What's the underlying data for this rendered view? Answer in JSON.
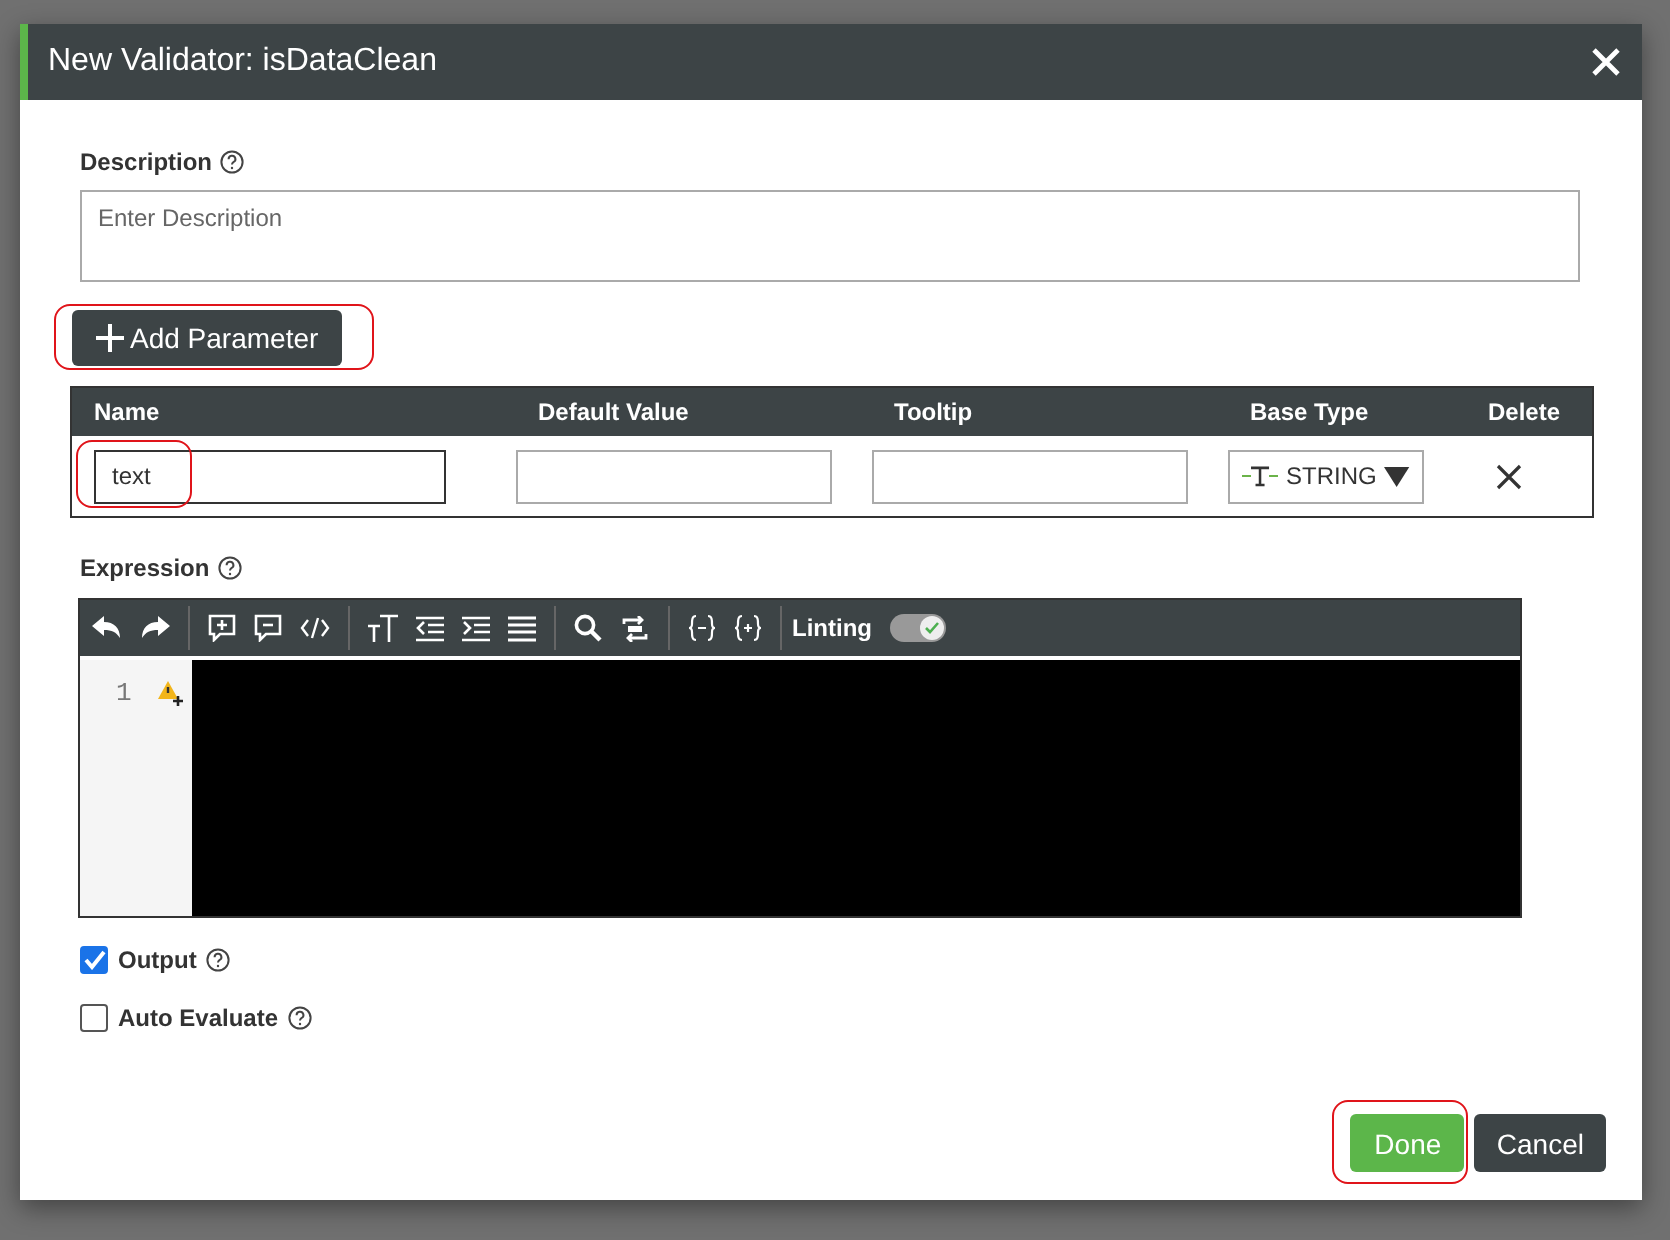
{
  "dialog": {
    "title": "New Validator: isDataClean"
  },
  "description": {
    "label": "Description",
    "placeholder": "Enter Description"
  },
  "add_parameter": {
    "label": "Add Parameter",
    "highlighted": true
  },
  "parameters": {
    "columns": [
      "Name",
      "Default Value",
      "Tooltip",
      "Base Type",
      "Delete"
    ],
    "rows": [
      {
        "name": "text",
        "name_highlighted": true,
        "default_value": "",
        "tooltip": "",
        "base_type": "STRING"
      }
    ]
  },
  "expression": {
    "label": "Expression",
    "linting_label": "Linting",
    "linting_on": true,
    "line_numbers": [
      "1"
    ]
  },
  "options": [
    {
      "label": "Output",
      "checked": true
    },
    {
      "label": "Auto Evaluate",
      "checked": false
    }
  ],
  "buttons": [
    {
      "label": "Done",
      "kind": "primary",
      "highlighted": true
    },
    {
      "label": "Cancel",
      "kind": "secondary",
      "highlighted": false
    }
  ]
}
